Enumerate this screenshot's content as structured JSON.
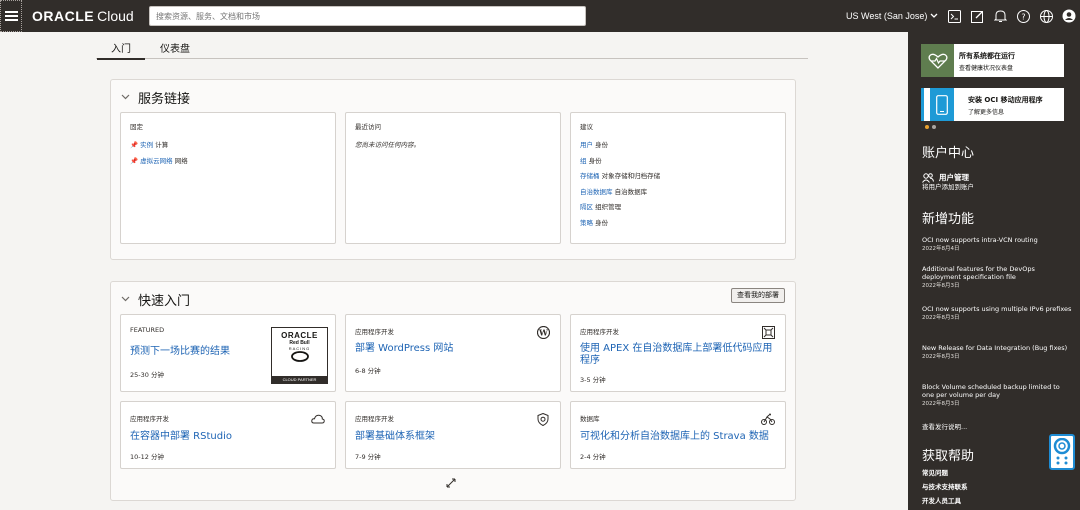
{
  "topbar": {
    "brand_oracle": "ORACLE",
    "brand_cloud": "Cloud",
    "search_placeholder": "搜索资源、服务、文档和市场",
    "region": "US West (San Jose)",
    "icons": [
      "terminal-icon",
      "edit-icon",
      "bell-icon",
      "help-icon",
      "globe-icon",
      "user-icon"
    ]
  },
  "tabs": [
    {
      "label": "入门",
      "active": true
    },
    {
      "label": "仪表盘",
      "active": false
    }
  ],
  "service_links": {
    "title": "服务链接",
    "pinned": {
      "head": "固定",
      "items": [
        {
          "link": "实例",
          "text": "计算"
        },
        {
          "link": "虚拟云网络",
          "text": "网络"
        }
      ]
    },
    "recent": {
      "head": "最近访问",
      "empty": "您尚未访问任何内容。"
    },
    "suggested": {
      "head": "建议",
      "items": [
        {
          "link": "用户",
          "text": "身份"
        },
        {
          "link": "组",
          "text": "身份"
        },
        {
          "link": "存储桶",
          "text": "对象存储和归档存储"
        },
        {
          "link": "自治数据库",
          "text": "自治数据库"
        },
        {
          "link": "隔区",
          "text": "组织管理"
        },
        {
          "link": "策略",
          "text": "身份"
        }
      ]
    }
  },
  "quickstart": {
    "title": "快速入门",
    "deploy_button": "查看我的部署",
    "featured_image": {
      "l1": "ORACLE",
      "l2": "Red Bull",
      "l3": "RACING",
      "l4": "CLOUD PARTNER"
    },
    "cards": [
      {
        "head": "FEATURED",
        "title": "预测下一场比赛的结果",
        "time": "25-30 分钟",
        "icon": "oracle-redbull-logo"
      },
      {
        "head": "应用程序开发",
        "title": "部署 WordPress 网站",
        "time": "6-8 分钟",
        "icon": "wordpress-icon"
      },
      {
        "head": "应用程序开发",
        "title": "使用 APEX 在自治数据库上部署低代码应用程序",
        "time": "3-5 分钟",
        "icon": "apex-icon"
      },
      {
        "head": "应用程序开发",
        "title": "在容器中部署 RStudio",
        "time": "10-12 分钟",
        "icon": "cloud-icon"
      },
      {
        "head": "应用程序开发",
        "title": "部署基础体系框架",
        "time": "7-9 分钟",
        "icon": "shield-icon"
      },
      {
        "head": "数据库",
        "title": "可视化和分析自治数据库上的 Strava 数据",
        "time": "2-4 分钟",
        "icon": "bike-icon"
      }
    ]
  },
  "sidebar": {
    "promos": [
      {
        "title": "所有系统都在运行",
        "sub": "查看健康状况仪表盘",
        "icon": "heart-pulse-icon",
        "color": "#5f7d4f"
      },
      {
        "title": "安装 OCI 移动应用程序",
        "sub": "了解更多信息",
        "icon": "mobile-icon",
        "color": "#1e9ad6"
      }
    ],
    "account_title": "账户中心",
    "user_mgmt_title": "用户管理",
    "user_mgmt_sub": "将用户添加到账户",
    "whatsnew_title": "新增功能",
    "news": [
      {
        "text": "OCI now supports intra-VCN routing",
        "date": "2022年8月4日"
      },
      {
        "text": "Additional features for the DevOps deployment specification file",
        "date": "2022年8月3日"
      },
      {
        "text": "OCI now supports using multiple IPv6 prefixes",
        "date": "2022年8月3日"
      },
      {
        "text": "New Release for Data Integration (Bug fixes)",
        "date": "2022年8月3日"
      },
      {
        "text": "Block Volume scheduled backup limited to one per volume per day",
        "date": "2022年8月3日"
      }
    ],
    "release_notes": "查看发行说明...",
    "help_title": "获取帮助",
    "help_links": [
      "常见问题",
      "与技术支持联系",
      "开发人员工具"
    ]
  },
  "colors": {
    "topbar": "#312d2a",
    "link": "#1e64b4",
    "accent_blue": "#1e8cd4"
  }
}
